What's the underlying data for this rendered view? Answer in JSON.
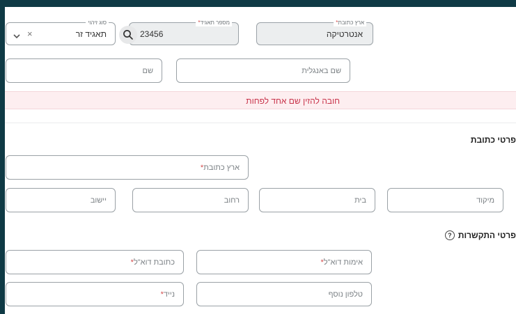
{
  "top_row": {
    "id_type": {
      "legend": "סוג זיהוי",
      "value": "תאגיד זר",
      "clear_glyph": "×",
      "chevron_glyph": "⌄"
    },
    "corp_number": {
      "legend": "מספר תאגיד",
      "required_mark": "*",
      "value": "23456"
    },
    "address_country": {
      "legend": "ארץ כתובת",
      "required_mark": "*",
      "value": "אנטרטיקה"
    }
  },
  "name_row": {
    "name": {
      "placeholder": "שם"
    },
    "english_name": {
      "placeholder": "שם באנגלית"
    }
  },
  "error": {
    "message": "חובה להזין שם אחד לפחות"
  },
  "address_section": {
    "title": "פרטי כתובת",
    "country": {
      "placeholder": "ארץ כתובת",
      "required_mark": "*"
    },
    "city": {
      "placeholder": "יישוב"
    },
    "street": {
      "placeholder": "רחוב"
    },
    "house": {
      "placeholder": "בית"
    },
    "zip": {
      "placeholder": "מיקוד"
    }
  },
  "contact_section": {
    "title": "פרטי התקשרות",
    "help_glyph": "?",
    "email": {
      "placeholder": "כתובת דוא\"ל",
      "required_mark": "*"
    },
    "email_confirm": {
      "placeholder": "אימות דוא\"ל",
      "required_mark": "*"
    },
    "mobile": {
      "placeholder": "נייד",
      "required_mark": "*"
    },
    "extra_phone": {
      "placeholder": "טלפון נוסף"
    }
  },
  "colors": {
    "backdrop": "#0f3a45",
    "required": "#d24a4a",
    "error_text": "#c8334a",
    "error_bg": "#fdeef0"
  }
}
